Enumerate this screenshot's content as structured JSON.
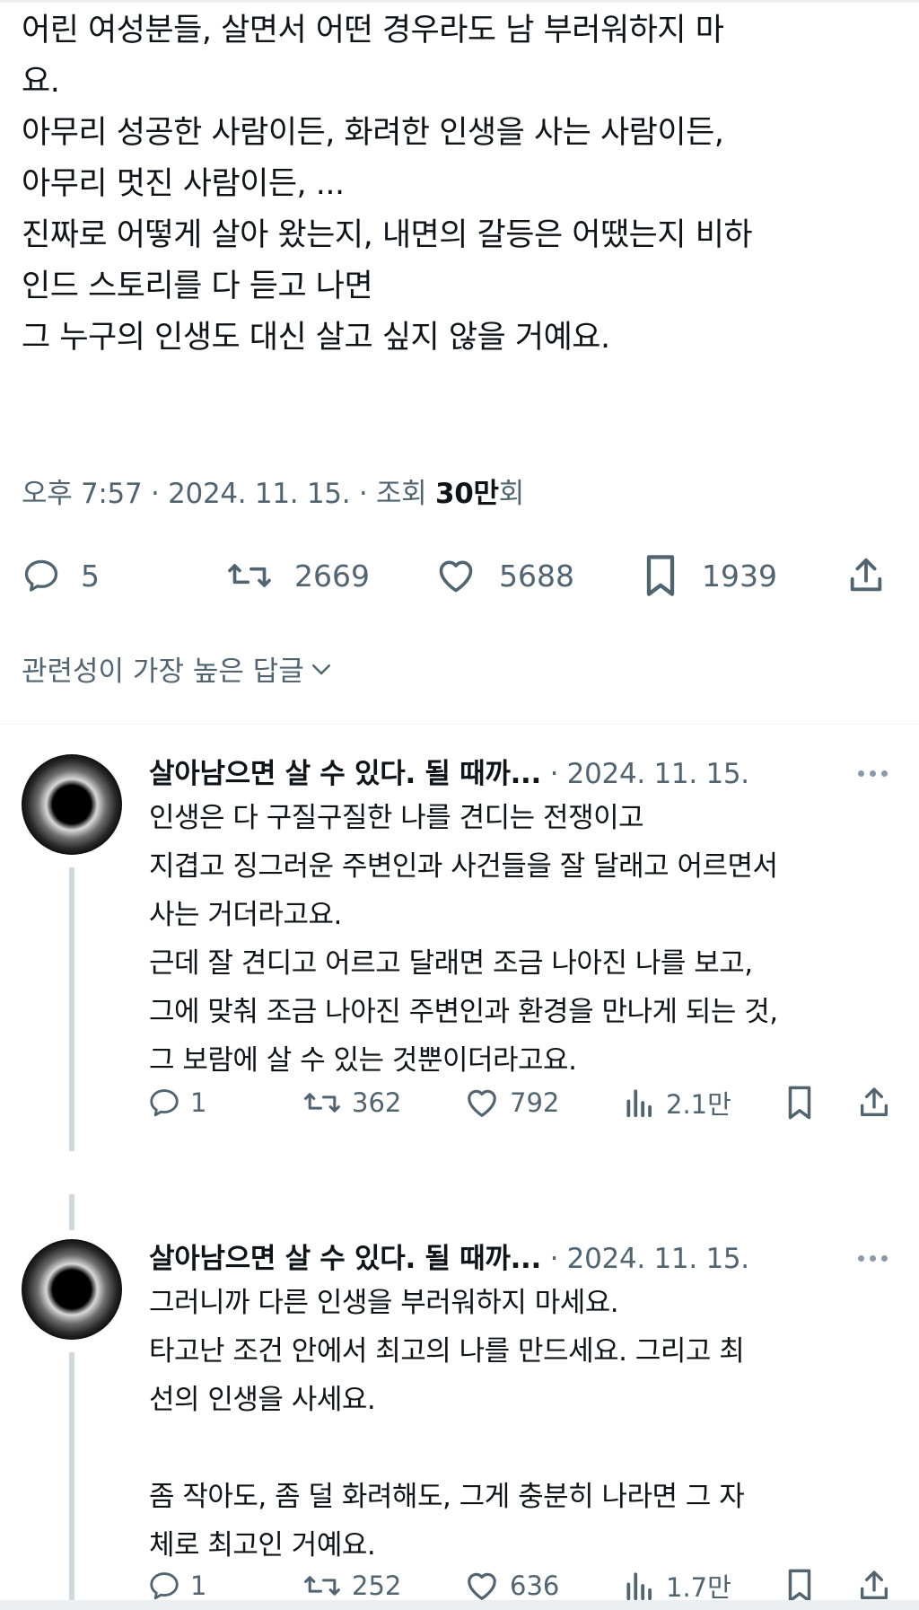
{
  "tweet": {
    "lines": [
      "어린 여성분들, 살면서 어떤 경우라도 남 부러워하지 마",
      "요.",
      "아무리 성공한 사람이든, 화려한 인생을 사는 사람이든,",
      "아무리 멋진 사람이든, ...",
      "진짜로 어떻게 살아 왔는지, 내면의 갈등은 어땠는지 비하",
      "인드 스토리를 다 듣고 나면",
      "그 누구의 인생도 대신 살고 싶지 않을 거예요."
    ],
    "meta": {
      "time": "오후 7:57",
      "date": "2024. 11. 15.",
      "views_label": "조회",
      "views_count": "30만",
      "views_suffix": "회",
      "separator": "·"
    },
    "stats": {
      "replies": "5",
      "retweets": "2669",
      "likes": "5688",
      "bookmarks": "1939"
    }
  },
  "replies_sort": {
    "label": "관련성이 가장 높은 답글"
  },
  "replies": [
    {
      "name": "살아남으면 살 수 있다. 될 때까...",
      "date": "· 2024. 11. 15.",
      "lines": [
        "인생은 다 구질구질한 나를 견디는 전쟁이고",
        "지겹고 징그러운 주변인과 사건들을 잘 달래고 어르면서",
        "사는 거더라고요.",
        "근데 잘 견디고 어르고 달래면 조금 나아진 나를 보고,",
        "그에 맞춰 조금 나아진 주변인과 환경을 만나게 되는 것,",
        "그 보람에 살 수 있는 것뿐이더라고요."
      ],
      "stats": {
        "replies": "1",
        "retweets": "362",
        "likes": "792",
        "views": "2.1만"
      }
    },
    {
      "name": "살아남으면 살 수 있다. 될 때까...",
      "date": "· 2024. 11. 15.",
      "lines": [
        "그러니까 다른 인생을 부러워하지 마세요.",
        "타고난 조건 안에서 최고의 나를 만드세요. 그리고 최",
        "선의 인생을 사세요.",
        "",
        "좀 작아도, 좀 덜 화려해도, 그게 충분히 나라면 그 자",
        "체로 최고인 거예요."
      ],
      "stats": {
        "replies": "1",
        "retweets": "252",
        "likes": "636",
        "views": "1.7만"
      }
    }
  ],
  "icons": {
    "reply": "reply-icon",
    "retweet": "retweet-icon",
    "like": "heart-icon",
    "bookmark": "bookmark-icon",
    "share": "share-icon",
    "views": "analytics-icon",
    "more": "more-icon",
    "chevron": "chevron-down-icon"
  },
  "colors": {
    "text": "#0f1419",
    "secondary": "#536471",
    "thread_line": "#cfd9de"
  }
}
